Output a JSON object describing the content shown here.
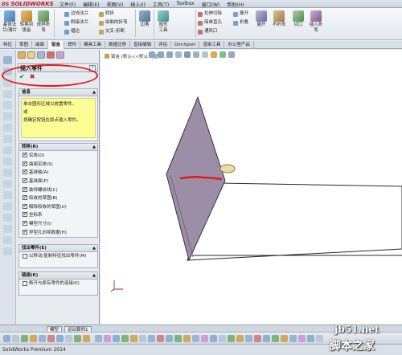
{
  "app": {
    "logo_text": "SOLIDWORKS",
    "logo_mark": "DS"
  },
  "menu": [
    "文件(F)",
    "编辑(E)",
    "视图(V)",
    "插入(I)",
    "工具(T)",
    "Toolbox",
    "窗口(W)",
    "帮助(H)"
  ],
  "ribbon": {
    "big_buttons": [
      {
        "label": "基体法兰/薄片",
        "icon": "base-flange-icon"
      },
      {
        "label": "转换到钣金",
        "icon": "convert-sheetmetal-icon"
      },
      {
        "label": "放样折弯",
        "icon": "lofted-bend-icon"
      }
    ],
    "small_col1": [
      "边线法兰",
      "斜接法兰",
      "褶边"
    ],
    "small_col2": [
      "转折",
      "绘制的折弯",
      "交叉-折断"
    ],
    "mid_buttons": [
      {
        "label": "边角",
        "icon": "corner-icon"
      },
      {
        "label": "成形工具",
        "icon": "forming-tool-icon"
      }
    ],
    "small_col3": [
      "拉伸切除",
      "简单直孔",
      "通风口"
    ],
    "right_buttons": [
      {
        "label": "展开",
        "icon": "unfold-icon"
      },
      {
        "label": "折叠",
        "icon": "fold-icon"
      },
      {
        "label": "展开",
        "icon": "flatten-icon"
      },
      {
        "label": "不折弯",
        "icon": "no-bends-icon"
      },
      {
        "label": "切口",
        "icon": "rip-icon"
      },
      {
        "label": "插入折弯",
        "icon": "insert-bends-icon"
      }
    ]
  },
  "cm_tabs": [
    "特征",
    "草图",
    "曲面",
    "钣金",
    "焊件",
    "模具工具",
    "数据迁移",
    "直接编辑",
    "评估",
    "DimXpert",
    "渲染工具",
    "办公室产品"
  ],
  "cm_active": "钣金",
  "viewport": {
    "crumb": "钣金 (默认<<默认>_显示..."
  },
  "property_manager": {
    "title": "插入零件",
    "help": "?",
    "ok": "✔",
    "cancel": "✖",
    "info_header": "信息",
    "info_lines": [
      "单击图形区域以放置零件。",
      "或",
      "按确定按钮在原点插入零件。"
    ],
    "transfer_header": "转移(R)",
    "transfer_items": [
      {
        "label": "实体(D)",
        "checked": true
      },
      {
        "label": "曲面实体(S)",
        "checked": true
      },
      {
        "label": "基准轴(A)",
        "checked": true
      },
      {
        "label": "基准面(P)",
        "checked": true
      },
      {
        "label": "装饰螺纹线(C)",
        "checked": true
      },
      {
        "label": "吸收的草图(B)",
        "checked": true
      },
      {
        "label": "解除吸收的草图(U)",
        "checked": true
      },
      {
        "label": "坐标系",
        "checked": true
      },
      {
        "label": "模型尺寸(I)",
        "checked": true
      },
      {
        "label": "异型孔向导数据(H)",
        "checked": true
      }
    ],
    "find_header": "找出零件(E)",
    "find_item": {
      "label": "以移动/复制特征找出零件(M)",
      "checked": false
    },
    "link_header": "链接(K)",
    "link_item": {
      "label": "断开与原有零件的连接(K)",
      "checked": false
    }
  },
  "bottom_tabs": [
    "模型",
    "运动算例1"
  ],
  "status": "SolidWorks Premium 2014",
  "watermark": {
    "line1": "jb51.net",
    "line2": "脚本之家"
  },
  "colors": {
    "annotation_red": "#e21a1a",
    "plane_face": "#9c8ea6",
    "info_yellow": "#fdfd96"
  }
}
